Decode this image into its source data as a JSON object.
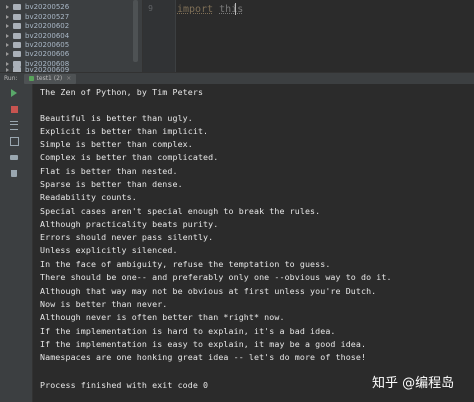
{
  "project": {
    "items": [
      "bv20200526",
      "bv20200527",
      "bv20200602",
      "bv20200604",
      "bv20200605",
      "bv20200606",
      "bv20200608",
      "bv20200609",
      "bv20200610"
    ]
  },
  "editor": {
    "line_number": "9",
    "keyword": "import",
    "module": "this"
  },
  "run": {
    "label": "Run:",
    "tab": "test1 (2)",
    "tab_close": "×"
  },
  "console": {
    "lines": [
      "The Zen of Python, by Tim Peters",
      "",
      "Beautiful is better than ugly.",
      "Explicit is better than implicit.",
      "Simple is better than complex.",
      "Complex is better than complicated.",
      "Flat is better than nested.",
      "Sparse is better than dense.",
      "Readability counts.",
      "Special cases aren't special enough to break the rules.",
      "Although practicality beats purity.",
      "Errors should never pass silently.",
      "Unless explicitly silenced.",
      "In the face of ambiguity, refuse the temptation to guess.",
      "There should be one-- and preferably only one --obvious way to do it.",
      "Although that way may not be obvious at first unless you're Dutch.",
      "Now is better than never.",
      "Although never is often better than *right* now.",
      "If the implementation is hard to explain, it's a bad idea.",
      "If the implementation is easy to explain, it may be a good idea.",
      "Namespaces are one honking great idea -- let's do more of those!",
      "",
      "Process finished with exit code 0"
    ]
  },
  "watermark": "知乎 @编程岛"
}
